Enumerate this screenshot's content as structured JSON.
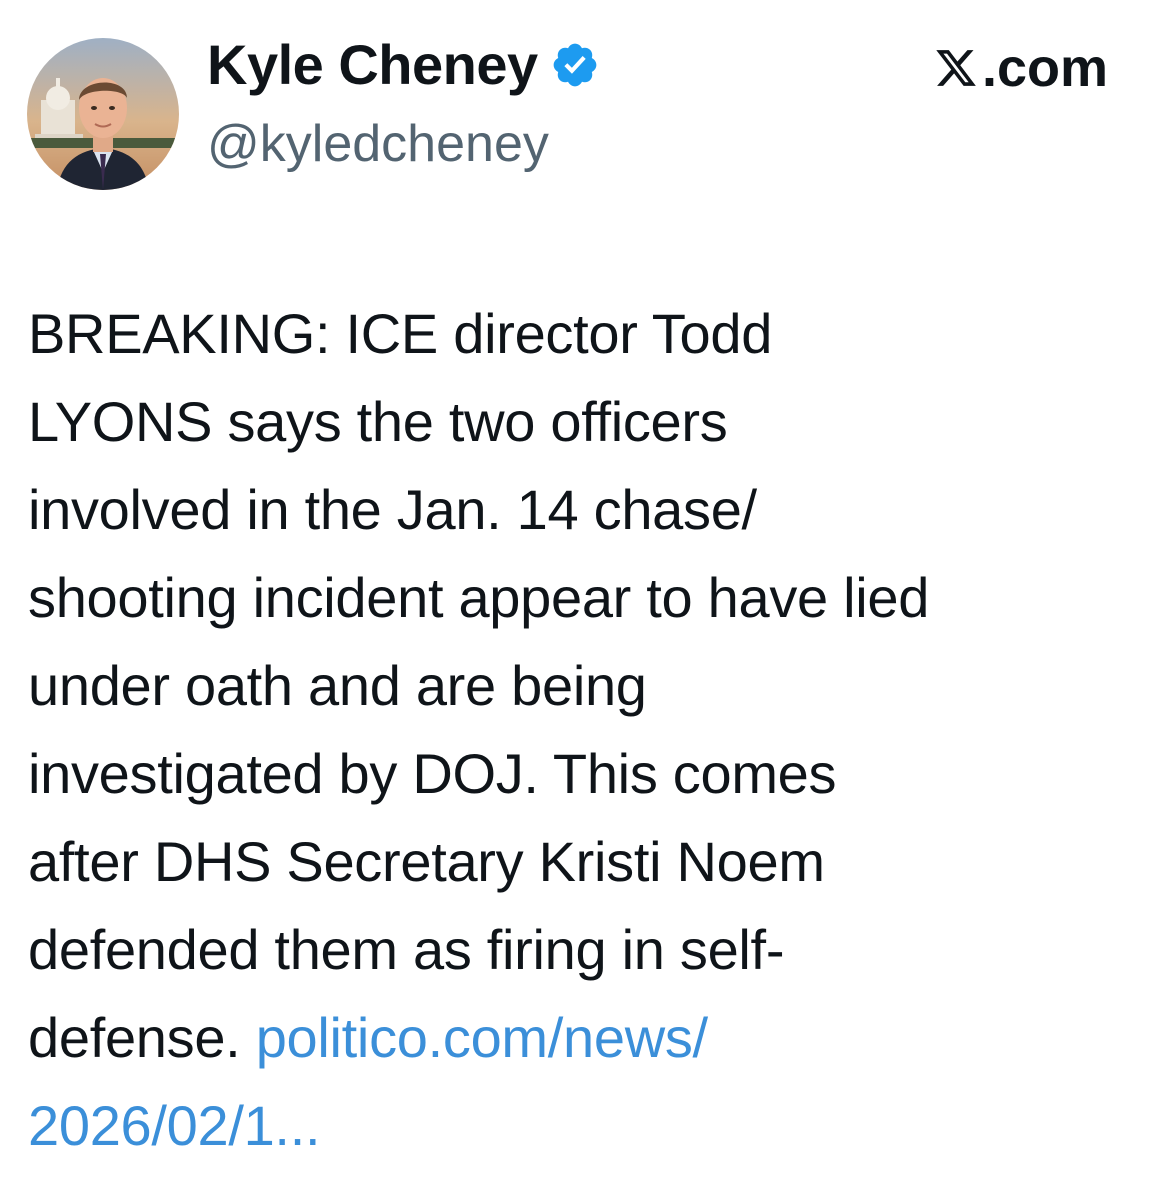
{
  "author": {
    "display_name": "Kyle Cheney",
    "handle": "@kyledcheney",
    "verified_icon": "verified-badge-icon",
    "avatar_icon": "profile-photo"
  },
  "brand": {
    "label": ".com",
    "logo_icon": "x-logo-icon"
  },
  "tweet": {
    "lines": [
      "BREAKING: ICE director Todd",
      "LYONS says the two officers",
      "involved in the Jan. 14 chase/",
      "shooting incident appear to have lied",
      "under oath and are being",
      "investigated by DOJ. This comes",
      "after DHS Secretary Kristi Noem",
      "defended them as firing in self-"
    ],
    "last_line_text": "defense. ",
    "link_part1": "politico.com/news/",
    "link_part2": "2026/02/1..."
  },
  "colors": {
    "text": "#0f1419",
    "handle": "#536471",
    "link": "#3b8fd9",
    "verified": "#1d9bf0"
  }
}
